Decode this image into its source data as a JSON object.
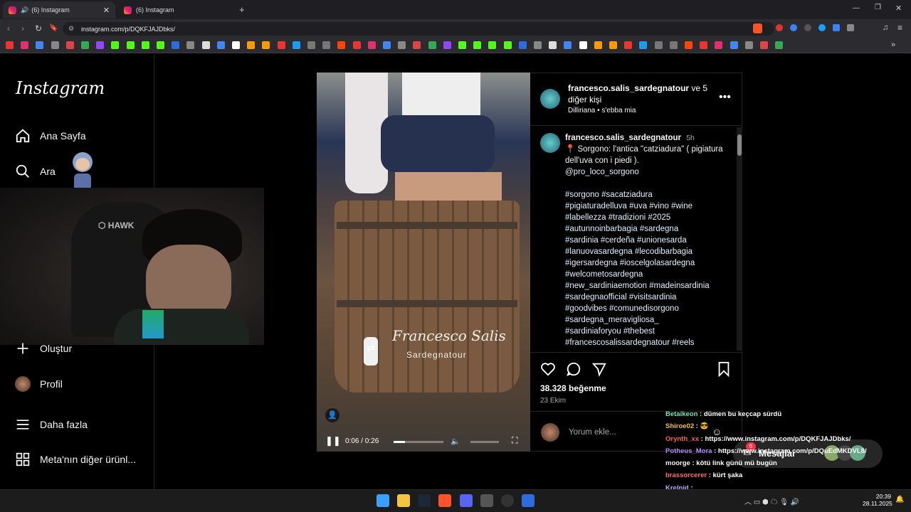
{
  "browser": {
    "tabs": [
      {
        "label": "(6) Instagram"
      },
      {
        "label": "(6) Instagram"
      }
    ],
    "url": "instagram.com/p/DQKFJAJDbks/"
  },
  "sidebar": {
    "logo": "Instagram",
    "items": [
      {
        "label": "Ana Sayfa",
        "icon": "home-icon"
      },
      {
        "label": "Ara",
        "icon": "search-icon"
      },
      {
        "label": "Oluştur",
        "icon": "plus-icon"
      },
      {
        "label": "Profil",
        "icon": "avatar"
      },
      {
        "label": "Daha fazla",
        "icon": "menu-icon"
      },
      {
        "label": "Meta'nın diğer ürünl...",
        "icon": "grid-icon"
      }
    ]
  },
  "post": {
    "author": "francesco.salis_sardegnatour",
    "coauthors": "ve 5 diğer kişi",
    "location": "Dilliriana • s'ebba mia",
    "caption_author": "francesco.salis_sardegnatour",
    "caption_time": "5h",
    "caption_text": "📍 Sorgono: l'antica \"catziadura\" ( pigiatura dell'uva con i piedi ).",
    "mention": "@pro_loco_sorgono",
    "hashtag_lines": [
      "#sorgono #sacatziadura",
      "#pigiaturadelluva #uva #vino #wine",
      "#labellezza #tradizioni #2025",
      "#autunnoinbarbagia #sardegna",
      "#sardinia #cerdeña #unionesarda",
      "#lanuovasardegna #lecodibarbagia",
      "#igersardegna #ioscelgolasardegna",
      "#welcometosardegna",
      "#new_sardiniaemotion #madeinsardinia",
      "#sardegnaofficial #visitsardinia",
      "#goodvibes #comunedisorgono",
      "#sardegna_meravigliosa_",
      "#sardiniaforyou #thebest",
      "#francescosalissardegnatour #reels"
    ],
    "likes": "38.328 beğenme",
    "date": "23 Ekim",
    "comment_placeholder": "Yorum ekle...",
    "watermark_name": "Francesco Salis",
    "watermark_sub": "Sardegnatour",
    "video_time": "0:06 / 0:26",
    "video_progress": 0.23
  },
  "messages": {
    "label": "Mesajlar",
    "badge": "6"
  },
  "chat": [
    {
      "user": "Betaikeon",
      "text": "dümen bu keçcap sürdü",
      "color": "#7de3b3"
    },
    {
      "user": "Shiroe02",
      "text": "😎",
      "color": "#f2c14e"
    },
    {
      "user": "Orynth_xx",
      "text": "https://www.instagram.com/p/DQKFJAJDbks/",
      "color": "#ff5e5e"
    },
    {
      "user": "Potheus_Mora",
      "text": "https://www.instagram.com/p/DQuEdMKDVL8/",
      "color": "#b48cff"
    },
    {
      "user": "moorge",
      "text": "kötü link günü mü bugün",
      "color": "#f5f5f5"
    },
    {
      "user": "brassorcerer",
      "text": "kürt şaka",
      "color": "#ff6a6a"
    },
    {
      "user": "Krelnid",
      "text": "",
      "color": "#b0b0ff"
    }
  ],
  "taskbar": {
    "time": "20:39",
    "date": "28.11.2025"
  }
}
